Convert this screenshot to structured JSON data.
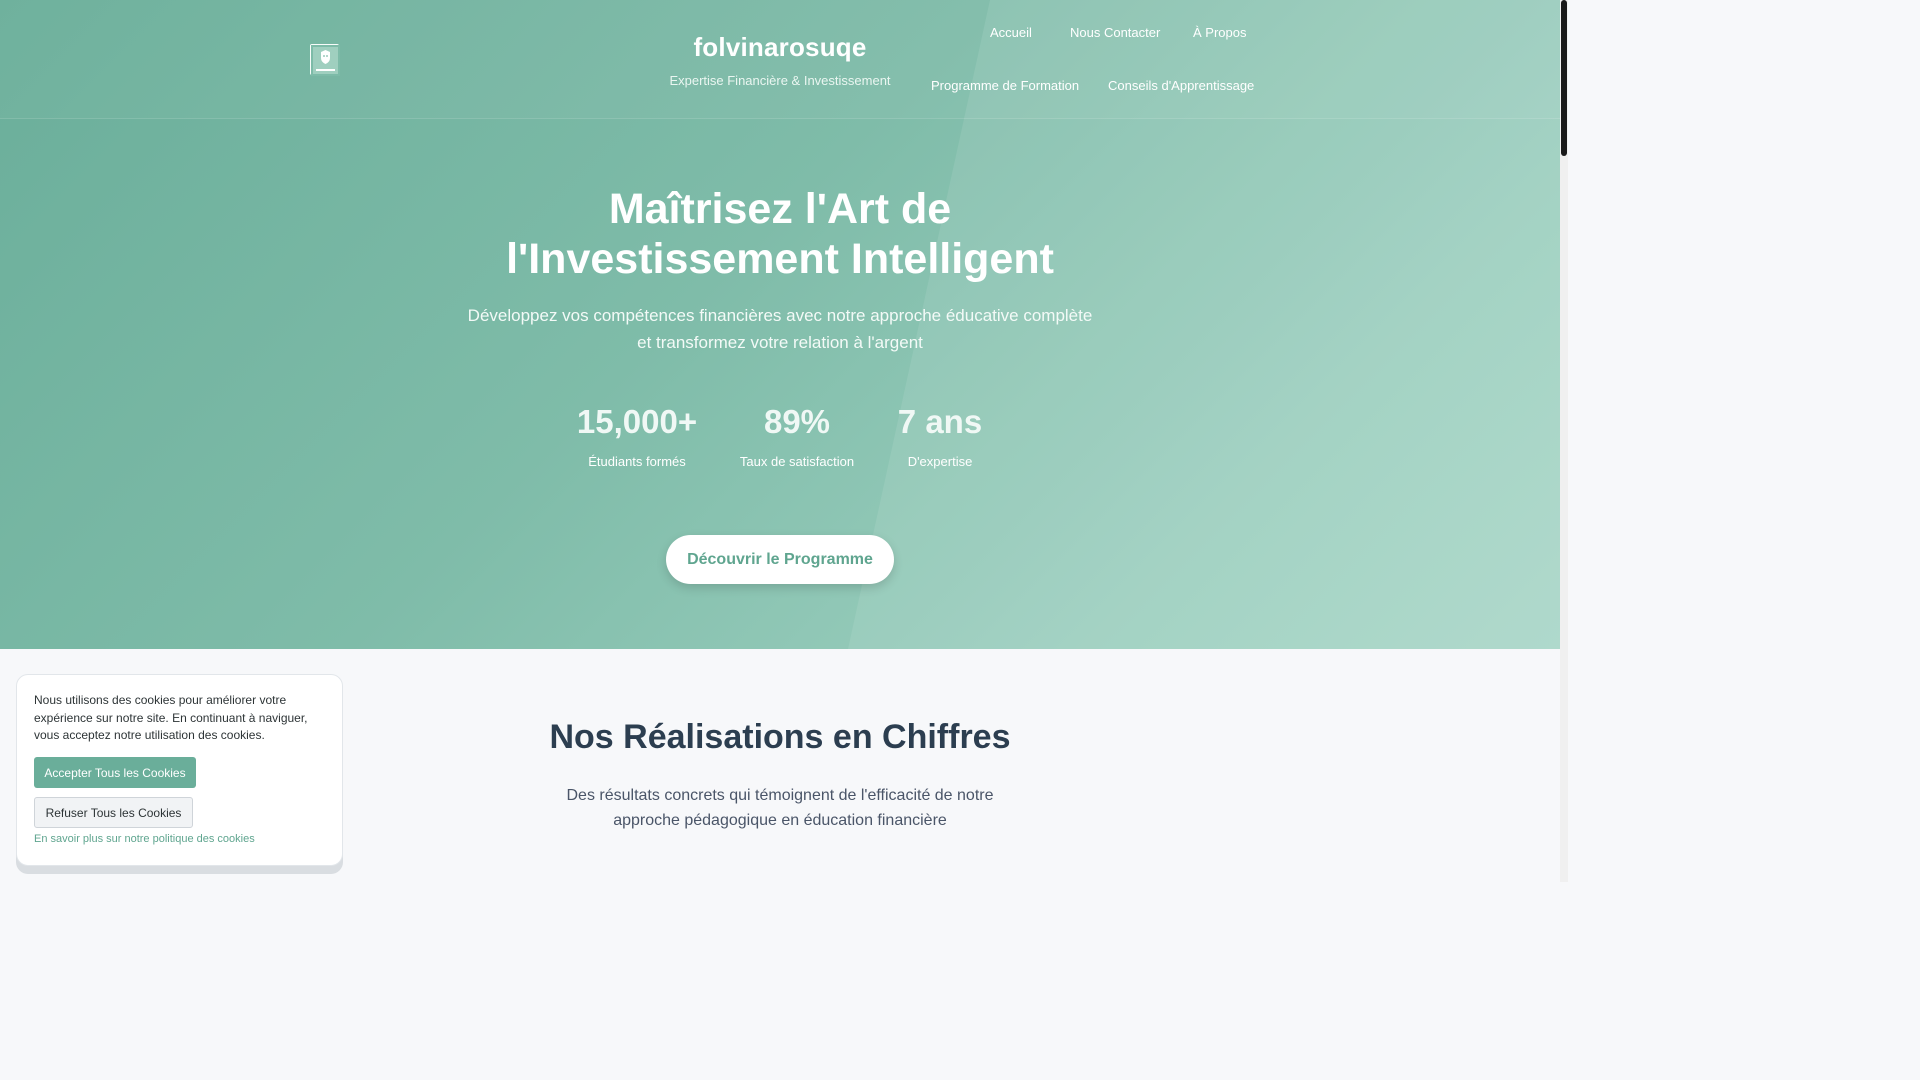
{
  "header": {
    "brand_name": "folvinarosuqe",
    "tagline": "Expertise Financière & Investissement",
    "nav": {
      "home": "Accueil",
      "contact": "Nous Contacter",
      "about": "À Propos",
      "program": "Programme de Formation",
      "tips": "Conseils d'Apprentissage"
    }
  },
  "hero": {
    "title_line1": "Maîtrisez l'Art de",
    "title_line2": "l'Investissement Intelligent",
    "subtitle_line1": "Développez vos compétences financières avec notre approche éducative complète",
    "subtitle_line2": "et transformez votre relation à l'argent",
    "stats": [
      {
        "value": "15,000+",
        "label": "Étudiants formés"
      },
      {
        "value": "89%",
        "label": "Taux de satisfaction"
      },
      {
        "value": "7 ans",
        "label": "D'expertise"
      }
    ],
    "cta": "Découvrir le Programme"
  },
  "achievements": {
    "title": "Nos Réalisations en Chiffres",
    "subtitle_line1": "Des résultats concrets qui témoignent de l'efficacité de notre",
    "subtitle_line2": "approche pédagogique en éducation financière"
  },
  "cookie_banner": {
    "message": "Nous utilisons des cookies pour améliorer votre expérience sur notre site. En continuant à naviguer, vous acceptez notre utilisation des cookies.",
    "accept": "Accepter Tous les Cookies",
    "refuse": "Refuser Tous les Cookies",
    "policy_link": "En savoir plus sur notre politique des cookies"
  },
  "colors": {
    "accent": "#6aae9a",
    "heading": "#2c3e50",
    "cta_text": "#5fa58f"
  },
  "icons": {
    "logo": "shield-book-logo-icon"
  }
}
